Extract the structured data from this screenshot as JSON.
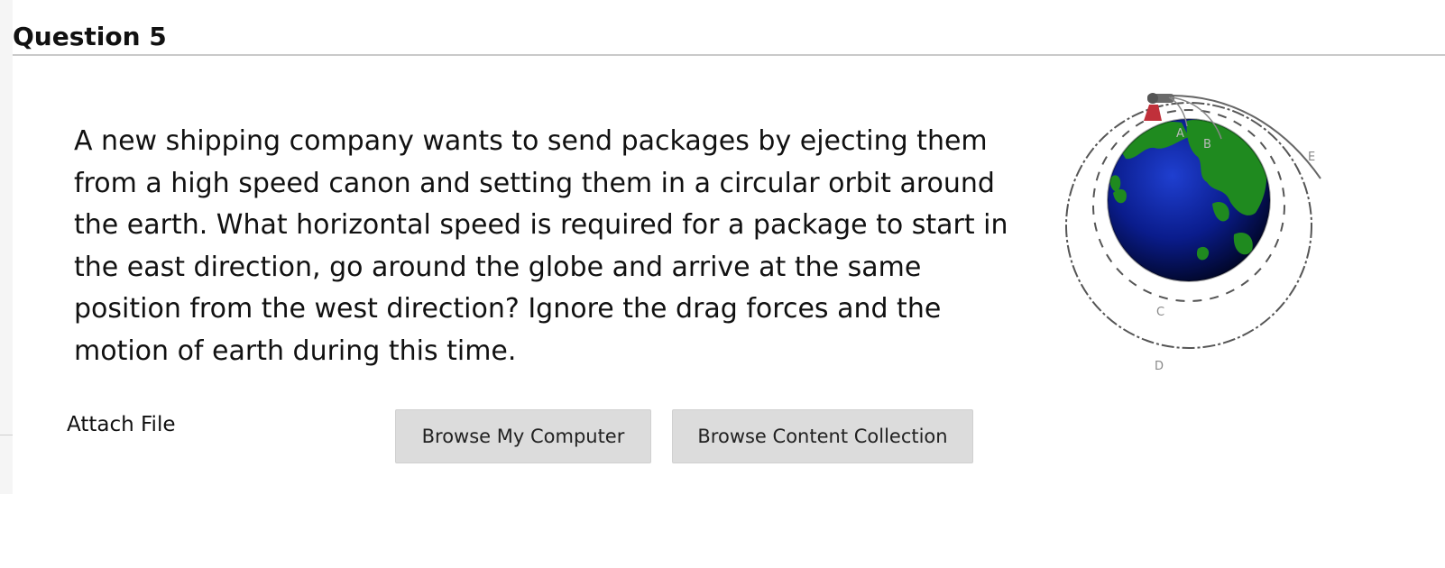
{
  "question": {
    "title": "Question 5",
    "text": "A new shipping company wants to send packages by ejecting them from a high speed canon and setting them in a circular orbit around the earth. What horizontal speed is required for a package to start in the east direction, go around the globe and arrive at the same position from the west direction? Ignore the drag forces and the motion of earth during this time."
  },
  "diagram": {
    "labels": {
      "a": "A",
      "b": "B",
      "c": "C",
      "d": "D",
      "e": "E"
    },
    "colors": {
      "ocean": "#0a1c8c",
      "land": "#1f8a1f",
      "cannon": "#c0303a",
      "orbit": "#555555"
    }
  },
  "attach": {
    "label": "Attach File",
    "browse_computer": "Browse My Computer",
    "browse_content": "Browse Content Collection"
  }
}
